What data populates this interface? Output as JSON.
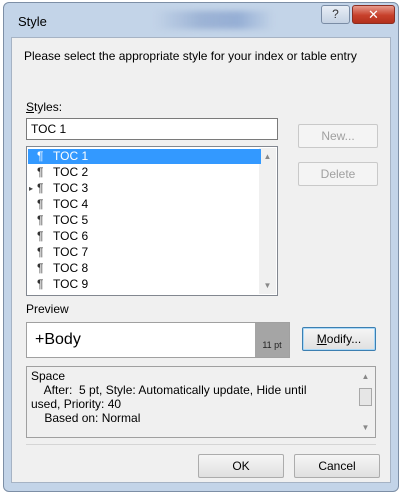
{
  "window": {
    "title": "Style",
    "help_glyph": "?",
    "close_glyph": "✕"
  },
  "instruction": "Please select the appropriate style for your index or table entry",
  "styles_label": "Styles:",
  "styles_input": "TOC 1",
  "styles_list": {
    "paragraph_mark": "¶",
    "items": [
      "TOC 1",
      "TOC 2",
      "TOC 3",
      "TOC 4",
      "TOC 5",
      "TOC 6",
      "TOC 7",
      "TOC 8",
      "TOC 9"
    ],
    "selected": "TOC 1",
    "collapsed_marker": "▸"
  },
  "buttons": {
    "new": "New...",
    "delete": "Delete",
    "modify": "Modify...",
    "ok": "OK",
    "cancel": "Cancel"
  },
  "preview_label": "Preview",
  "preview": {
    "font_name": "+Body",
    "size": "11 pt"
  },
  "description": {
    "lines": [
      "Space",
      "    After:  5 pt, Style: Automatically update, Hide until",
      "used, Priority: 40",
      "    Based on: Normal"
    ]
  }
}
